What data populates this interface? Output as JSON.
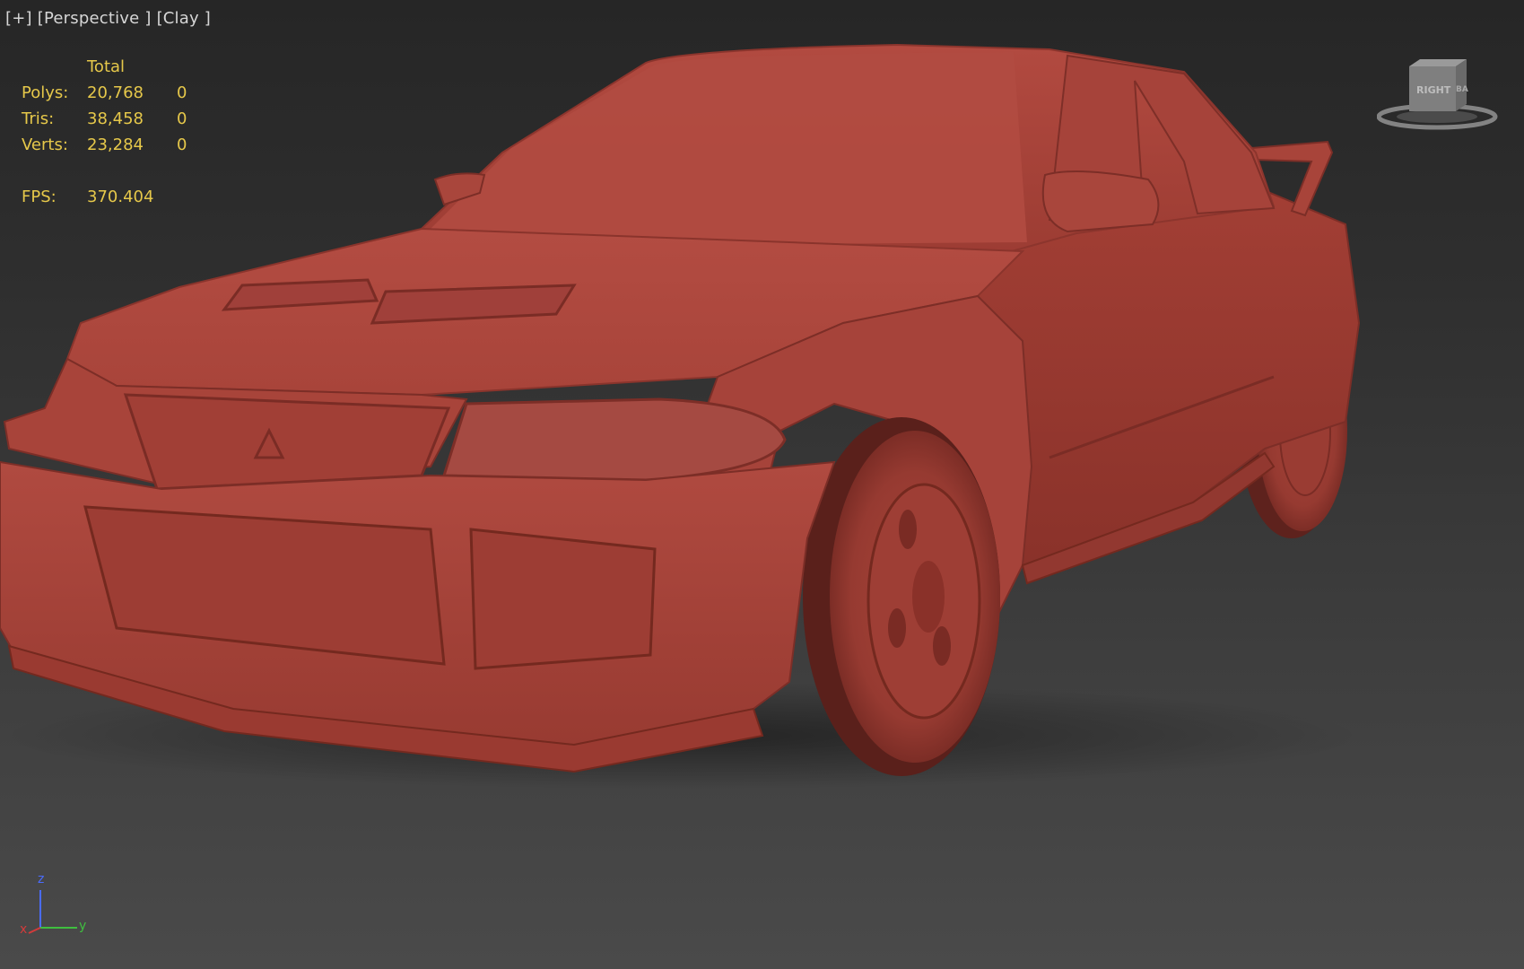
{
  "viewport": {
    "label_plus": "[+]",
    "label_view": "[Perspective ]",
    "label_shading": "[Clay ]"
  },
  "stats": {
    "header": "Total",
    "rows": [
      {
        "label": "Polys:",
        "total": "20,768",
        "selected": "0"
      },
      {
        "label": "Tris:",
        "total": "38,458",
        "selected": "0"
      },
      {
        "label": "Verts:",
        "total": "23,284",
        "selected": "0"
      }
    ],
    "fps_label": "FPS:",
    "fps_value": "370.404"
  },
  "viewcube": {
    "face_left": "RIGHT",
    "face_right": "BA"
  },
  "axis": {
    "x": "x",
    "y": "y",
    "z": "z"
  },
  "colors": {
    "stats_text": "#e6c84a",
    "label_text": "#d6d6d6",
    "clay_body": "#b04a3f",
    "axis_x": "#d23b3b",
    "axis_y": "#3fbf3f",
    "axis_z": "#4a6cff"
  },
  "icons": {
    "viewcube": "viewcube-icon",
    "axis": "axis-tripod-icon"
  }
}
